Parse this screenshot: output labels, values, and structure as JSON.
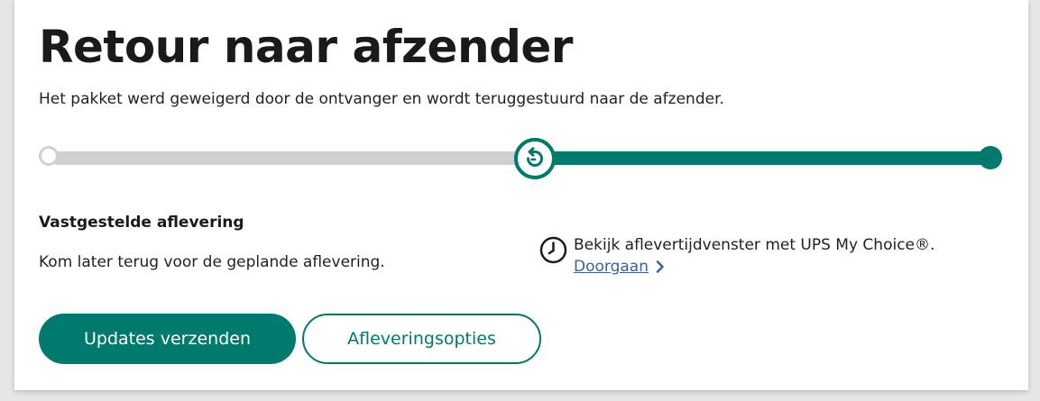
{
  "status": {
    "title": "Retour naar afzender",
    "description": "Het pakket werd geweigerd door de ontvanger en wordt teruggestuurd naar de afzender."
  },
  "progress": {
    "fraction": 0.5,
    "current_step_icon": "return-arrow-icon",
    "accent_color": "#007a6c",
    "track_color": "#d0d0d0"
  },
  "delivery": {
    "heading": "Vastgestelde aflevering",
    "text": "Kom later terug voor de geplande aflevering."
  },
  "my_choice": {
    "icon": "clock-icon",
    "text": "Bekijk aflevertijdvenster met UPS My Choice®.",
    "link_label": "Doorgaan"
  },
  "buttons": {
    "primary_label": "Updates verzenden",
    "secondary_label": "Afleveringsopties"
  }
}
